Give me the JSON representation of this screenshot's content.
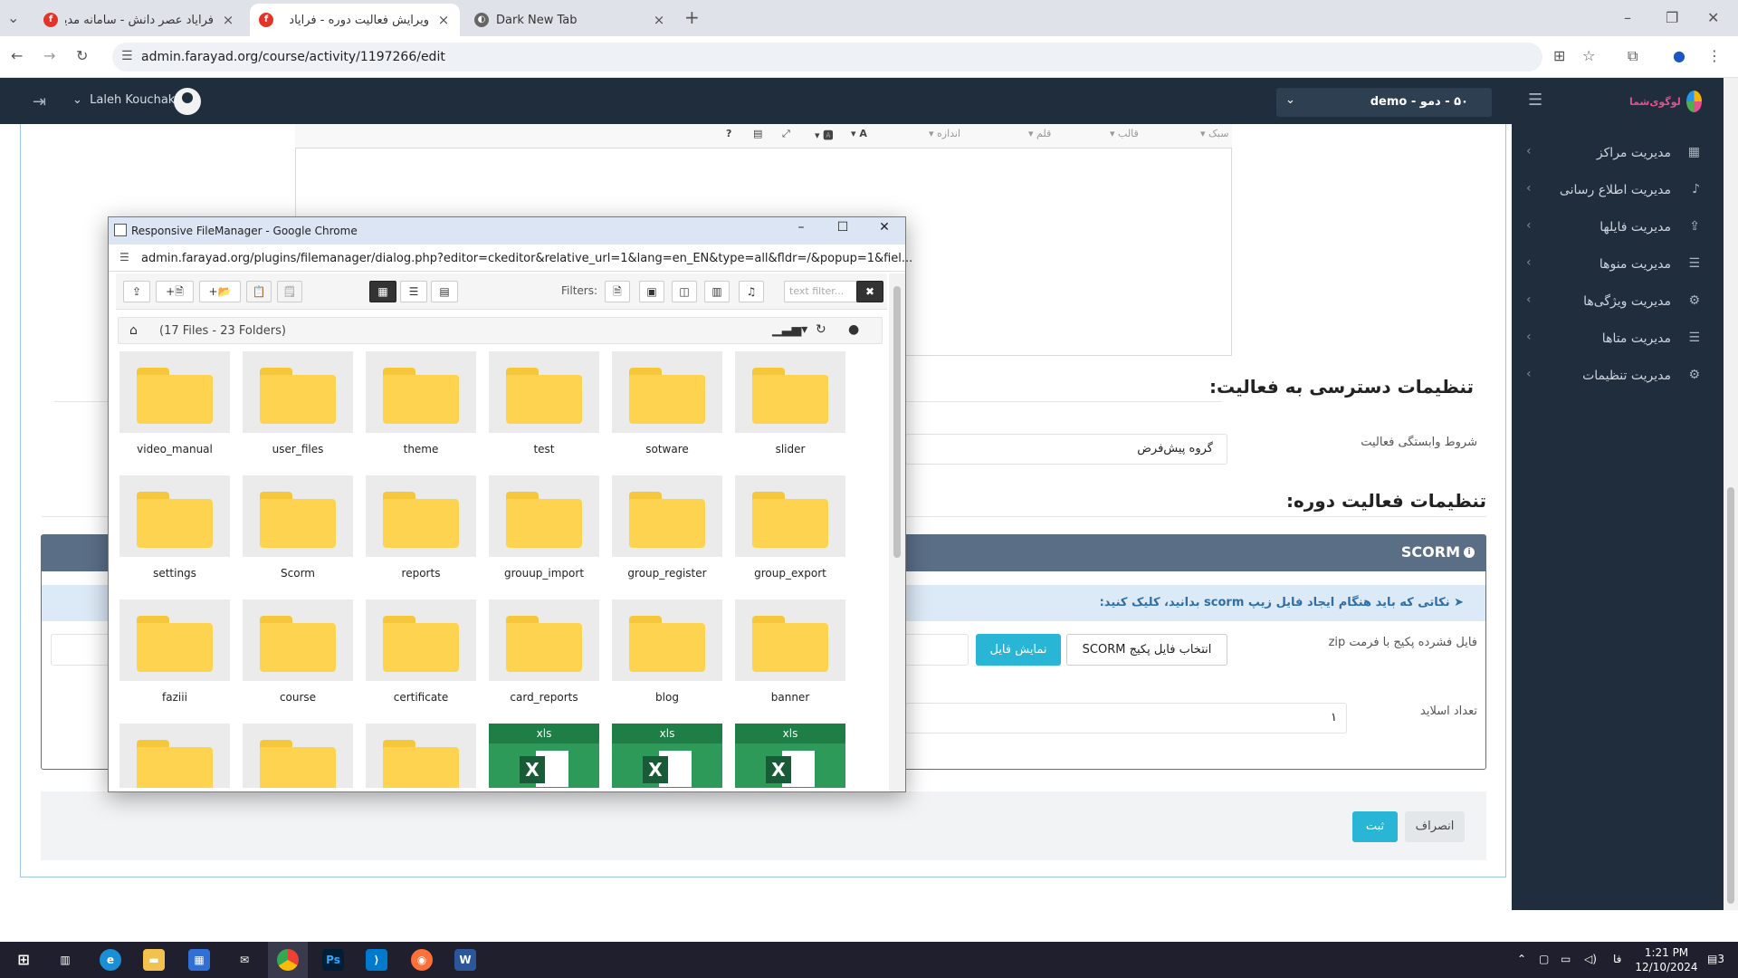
{
  "browser": {
    "tabs": [
      {
        "title": "فرایاد عصر دانش - سامانه مدیری...",
        "active": false
      },
      {
        "title": "ویرایش فعالیت دوره - فرایاد",
        "active": true
      },
      {
        "title": "Dark New Tab",
        "active": false
      }
    ],
    "url": "admin.farayad.org/course/activity/1197266/edit"
  },
  "header": {
    "user_name": "Laleh Kouchaki",
    "org_select": "۵۰ - دمو - demo",
    "logo_text": "لوگوی‌شما"
  },
  "sidebar": {
    "items": [
      {
        "label": "مدیریت مراکز",
        "icon": "building-icon"
      },
      {
        "label": "مدیریت اطلاع رسانی",
        "icon": "bell-icon"
      },
      {
        "label": "مدیریت فایلها",
        "icon": "upload-icon"
      },
      {
        "label": "مدیریت منوها",
        "icon": "list-icon"
      },
      {
        "label": "مدیریت ویژگی‌ها",
        "icon": "gear-icon"
      },
      {
        "label": "مدیریت متاها",
        "icon": "list-icon"
      },
      {
        "label": "مدیریت تنظیمات",
        "icon": "gear-icon"
      }
    ]
  },
  "editor": {
    "toolbar": [
      "سبک",
      "قالب",
      "قلم",
      "اندازه"
    ]
  },
  "form": {
    "access_title": "تنظیمات دسترسی به فعالیت:",
    "dependency_label": "شروط وابستگی فعالیت",
    "dependency_value": "گروه پیش‌فرض",
    "course_title": "تنظیمات فعالیت دوره:",
    "scorm_title": "SCORM",
    "scorm_alert": "➤ نکاتی که باید هنگام ایجاد فایل زیپ scorm بدانید، کلیک کنید:",
    "zip_label": "فایل فشرده پکیج با فرمت zip",
    "choose_button": "انتخاب فایل پکیج SCORM",
    "show_button": "نمایش فایل",
    "slides_label": "تعداد اسلاید",
    "slides_value": "۱",
    "submit_button": "ثبت",
    "cancel_button": "انصراف"
  },
  "filemanager": {
    "window_title": "Responsive FileManager - Google Chrome",
    "url": "admin.farayad.org/plugins/filemanager/dialog.php?editor=ckeditor&relative_url=1&lang=en_EN&type=all&fldr=/&popup=1&fiel...",
    "filters_label": "Filters:",
    "filter_placeholder": "text filter...",
    "count_text": "(17 Files - 23 Folders)",
    "items": [
      {
        "name": "video_manual",
        "type": "folder"
      },
      {
        "name": "user_files",
        "type": "folder"
      },
      {
        "name": "theme",
        "type": "folder"
      },
      {
        "name": "test",
        "type": "folder"
      },
      {
        "name": "sotware",
        "type": "folder"
      },
      {
        "name": "slider",
        "type": "folder"
      },
      {
        "name": "settings",
        "type": "folder"
      },
      {
        "name": "Scorm",
        "type": "folder"
      },
      {
        "name": "reports",
        "type": "folder"
      },
      {
        "name": "grouup_import",
        "type": "folder"
      },
      {
        "name": "group_register",
        "type": "folder"
      },
      {
        "name": "group_export",
        "type": "folder"
      },
      {
        "name": "faziii",
        "type": "folder"
      },
      {
        "name": "course",
        "type": "folder"
      },
      {
        "name": "certificate",
        "type": "folder"
      },
      {
        "name": "card_reports",
        "type": "folder"
      },
      {
        "name": "blog",
        "type": "folder"
      },
      {
        "name": "banner",
        "type": "folder"
      },
      {
        "name": "",
        "type": "folder"
      },
      {
        "name": "",
        "type": "folder"
      },
      {
        "name": "",
        "type": "folder"
      },
      {
        "name": "xls",
        "type": "xls"
      },
      {
        "name": "xls",
        "type": "xls"
      },
      {
        "name": "xls",
        "type": "xls"
      }
    ]
  },
  "taskbar": {
    "time": "1:21 PM",
    "date": "12/10/2024",
    "lang": "فا",
    "notifications": "3"
  },
  "colors": {
    "header_bg": "#1f2d3d",
    "accent": "#29b6d6",
    "scorm_head": "#5a6e86",
    "folder": "#fdd34f",
    "xls": "#1e7e45"
  }
}
